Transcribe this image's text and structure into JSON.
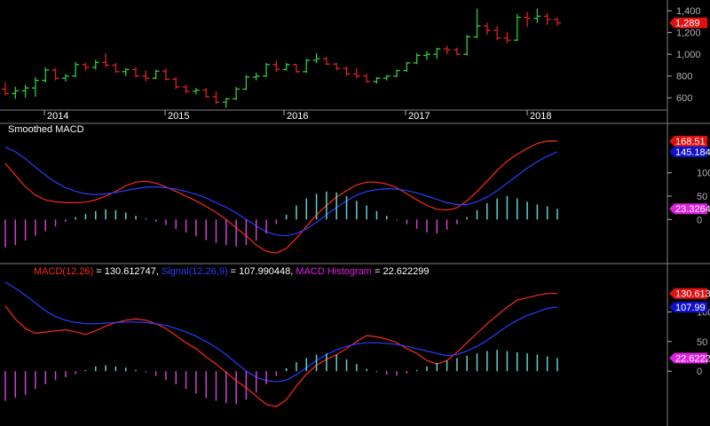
{
  "colors": {
    "background": "#000000",
    "up_bar": "#2ecc40",
    "down_bar": "#e02020",
    "macd_line": "#ff2a1a",
    "signal_line": "#2a3cff",
    "hist_pos": "#5fd3cf",
    "hist_neg": "#d040d0",
    "axis": "#b0b0b0",
    "text": "#ffffff"
  },
  "chart_data": [
    {
      "type": "ohlc",
      "name": "price",
      "x_ticks": [
        "2014",
        "2015",
        "2016",
        "2017",
        "2018"
      ],
      "y_ticks": [
        "1,400",
        "1,200",
        "1,000",
        "800",
        "600"
      ],
      "ylim": [
        520,
        1450
      ],
      "last_value_label": "1,289",
      "bars": [
        {
          "o": 680,
          "h": 745,
          "l": 620,
          "c": 640
        },
        {
          "o": 640,
          "h": 700,
          "l": 590,
          "c": 665
        },
        {
          "o": 665,
          "h": 720,
          "l": 600,
          "c": 690
        },
        {
          "o": 690,
          "h": 790,
          "l": 610,
          "c": 760
        },
        {
          "o": 760,
          "h": 880,
          "l": 740,
          "c": 855
        },
        {
          "o": 855,
          "h": 870,
          "l": 760,
          "c": 780
        },
        {
          "o": 780,
          "h": 820,
          "l": 750,
          "c": 800
        },
        {
          "o": 800,
          "h": 930,
          "l": 790,
          "c": 905
        },
        {
          "o": 905,
          "h": 920,
          "l": 850,
          "c": 880
        },
        {
          "o": 880,
          "h": 950,
          "l": 860,
          "c": 925
        },
        {
          "o": 925,
          "h": 1010,
          "l": 880,
          "c": 900
        },
        {
          "o": 900,
          "h": 920,
          "l": 830,
          "c": 840
        },
        {
          "o": 840,
          "h": 870,
          "l": 800,
          "c": 860
        },
        {
          "o": 860,
          "h": 880,
          "l": 790,
          "c": 800
        },
        {
          "o": 800,
          "h": 850,
          "l": 750,
          "c": 780
        },
        {
          "o": 780,
          "h": 860,
          "l": 770,
          "c": 845
        },
        {
          "o": 845,
          "h": 870,
          "l": 760,
          "c": 770
        },
        {
          "o": 770,
          "h": 790,
          "l": 680,
          "c": 700
        },
        {
          "o": 700,
          "h": 720,
          "l": 640,
          "c": 660
        },
        {
          "o": 660,
          "h": 690,
          "l": 630,
          "c": 670
        },
        {
          "o": 670,
          "h": 690,
          "l": 600,
          "c": 610
        },
        {
          "o": 610,
          "h": 660,
          "l": 540,
          "c": 560
        },
        {
          "o": 560,
          "h": 600,
          "l": 510,
          "c": 590
        },
        {
          "o": 590,
          "h": 700,
          "l": 580,
          "c": 680
        },
        {
          "o": 680,
          "h": 810,
          "l": 670,
          "c": 790
        },
        {
          "o": 790,
          "h": 830,
          "l": 760,
          "c": 800
        },
        {
          "o": 800,
          "h": 920,
          "l": 790,
          "c": 905
        },
        {
          "o": 905,
          "h": 940,
          "l": 840,
          "c": 860
        },
        {
          "o": 860,
          "h": 920,
          "l": 850,
          "c": 905
        },
        {
          "o": 905,
          "h": 910,
          "l": 830,
          "c": 840
        },
        {
          "o": 840,
          "h": 960,
          "l": 830,
          "c": 945
        },
        {
          "o": 945,
          "h": 1010,
          "l": 920,
          "c": 960
        },
        {
          "o": 960,
          "h": 975,
          "l": 900,
          "c": 910
        },
        {
          "o": 910,
          "h": 920,
          "l": 850,
          "c": 870
        },
        {
          "o": 870,
          "h": 890,
          "l": 800,
          "c": 820
        },
        {
          "o": 820,
          "h": 870,
          "l": 780,
          "c": 800
        },
        {
          "o": 800,
          "h": 820,
          "l": 740,
          "c": 750
        },
        {
          "o": 750,
          "h": 790,
          "l": 730,
          "c": 780
        },
        {
          "o": 780,
          "h": 810,
          "l": 760,
          "c": 800
        },
        {
          "o": 800,
          "h": 860,
          "l": 790,
          "c": 850
        },
        {
          "o": 850,
          "h": 930,
          "l": 840,
          "c": 920
        },
        {
          "o": 920,
          "h": 1010,
          "l": 910,
          "c": 990
        },
        {
          "o": 990,
          "h": 1030,
          "l": 950,
          "c": 1000
        },
        {
          "o": 1000,
          "h": 1060,
          "l": 960,
          "c": 1050
        },
        {
          "o": 1050,
          "h": 1080,
          "l": 1000,
          "c": 1040
        },
        {
          "o": 1040,
          "h": 1060,
          "l": 990,
          "c": 1000
        },
        {
          "o": 1000,
          "h": 1180,
          "l": 990,
          "c": 1160
        },
        {
          "o": 1160,
          "h": 1420,
          "l": 1150,
          "c": 1260
        },
        {
          "o": 1260,
          "h": 1290,
          "l": 1180,
          "c": 1220
        },
        {
          "o": 1220,
          "h": 1260,
          "l": 1130,
          "c": 1150
        },
        {
          "o": 1150,
          "h": 1200,
          "l": 1100,
          "c": 1130
        },
        {
          "o": 1130,
          "h": 1370,
          "l": 1120,
          "c": 1340
        },
        {
          "o": 1340,
          "h": 1390,
          "l": 1250,
          "c": 1330
        },
        {
          "o": 1330,
          "h": 1420,
          "l": 1290,
          "c": 1350
        },
        {
          "o": 1350,
          "h": 1380,
          "l": 1270,
          "c": 1320
        },
        {
          "o": 1320,
          "h": 1340,
          "l": 1260,
          "c": 1289
        }
      ]
    },
    {
      "type": "line",
      "name": "smoothed_macd",
      "title": "Smoothed MACD",
      "y_ticks": [
        "100",
        "50",
        "0"
      ],
      "ylim": [
        -85,
        185
      ],
      "series": [
        {
          "key": "macd",
          "label": "168.51",
          "values": [
            120,
            95,
            70,
            52,
            42,
            38,
            36,
            36,
            37,
            42,
            50,
            60,
            72,
            80,
            82,
            78,
            70,
            60,
            50,
            40,
            28,
            15,
            0,
            -18,
            -35,
            -55,
            -68,
            -72,
            -62,
            -40,
            -15,
            10,
            30,
            48,
            62,
            74,
            80,
            80,
            76,
            68,
            55,
            42,
            30,
            22,
            20,
            25,
            40,
            60,
            82,
            105,
            125,
            140,
            152,
            163,
            168,
            168
          ]
        },
        {
          "key": "signal",
          "label": "145.184",
          "values": [
            155,
            145,
            130,
            112,
            95,
            80,
            68,
            60,
            55,
            53,
            55,
            58,
            62,
            66,
            69,
            70,
            68,
            65,
            60,
            54,
            46,
            36,
            26,
            14,
            0,
            -14,
            -26,
            -33,
            -35,
            -30,
            -20,
            -6,
            10,
            26,
            40,
            52,
            60,
            64,
            66,
            65,
            62,
            57,
            50,
            43,
            36,
            32,
            32,
            38,
            48,
            62,
            78,
            94,
            110,
            124,
            136,
            145
          ]
        },
        {
          "key": "histogram",
          "label": "23.3264",
          "values": [
            -60,
            -55,
            -45,
            -35,
            -25,
            -15,
            -5,
            5,
            12,
            18,
            22,
            20,
            15,
            8,
            2,
            -5,
            -12,
            -20,
            -28,
            -36,
            -44,
            -50,
            -55,
            -58,
            -55,
            -45,
            -30,
            -10,
            10,
            30,
            45,
            55,
            60,
            58,
            50,
            40,
            30,
            18,
            8,
            -2,
            -10,
            -20,
            -28,
            -30,
            -22,
            -10,
            5,
            20,
            35,
            45,
            50,
            45,
            38,
            32,
            28,
            23
          ]
        }
      ]
    },
    {
      "type": "line",
      "name": "macd",
      "legend": [
        {
          "key": "macd",
          "text": "MACD(12,26)",
          "value": "= 130.612747"
        },
        {
          "key": "signal",
          "text": "Signal(12,26,9)",
          "value": "= 107.990448"
        },
        {
          "key": "histogram",
          "text": "MACD Histogram",
          "value": "= 22.622299"
        }
      ],
      "y_ticks": [
        "100",
        "50",
        "0"
      ],
      "ylim": [
        -85,
        165
      ],
      "series": [
        {
          "key": "macd",
          "label": "130.613",
          "values": [
            110,
            88,
            72,
            64,
            66,
            68,
            70,
            66,
            62,
            68,
            76,
            82,
            86,
            88,
            86,
            80,
            72,
            60,
            48,
            38,
            24,
            12,
            -2,
            -16,
            -28,
            -42,
            -56,
            -60,
            -48,
            -25,
            -5,
            10,
            20,
            28,
            38,
            50,
            60,
            58,
            54,
            48,
            38,
            30,
            18,
            12,
            18,
            32,
            48,
            64,
            80,
            94,
            108,
            120,
            124,
            128,
            131,
            131
          ]
        },
        {
          "key": "signal",
          "label": "107.99",
          "values": [
            150,
            140,
            128,
            115,
            102,
            92,
            86,
            82,
            80,
            80,
            81,
            82,
            83,
            83,
            82,
            80,
            77,
            72,
            66,
            59,
            50,
            40,
            28,
            14,
            0,
            -10,
            -16,
            -18,
            -15,
            -6,
            6,
            18,
            28,
            36,
            42,
            46,
            48,
            48,
            47,
            45,
            42,
            38,
            34,
            30,
            26,
            28,
            34,
            42,
            52,
            64,
            76,
            86,
            94,
            100,
            106,
            108
          ]
        },
        {
          "key": "histogram",
          "label": "22.6222",
          "values": [
            -50,
            -45,
            -40,
            -30,
            -22,
            -15,
            -10,
            -5,
            2,
            8,
            10,
            8,
            6,
            2,
            -2,
            -8,
            -15,
            -22,
            -30,
            -38,
            -45,
            -50,
            -54,
            -56,
            -48,
            -36,
            -22,
            -8,
            5,
            15,
            22,
            28,
            30,
            28,
            20,
            12,
            4,
            -2,
            -6,
            -8,
            -4,
            2,
            8,
            14,
            18,
            22,
            26,
            30,
            34,
            36,
            34,
            32,
            30,
            28,
            25,
            22
          ]
        }
      ]
    }
  ]
}
